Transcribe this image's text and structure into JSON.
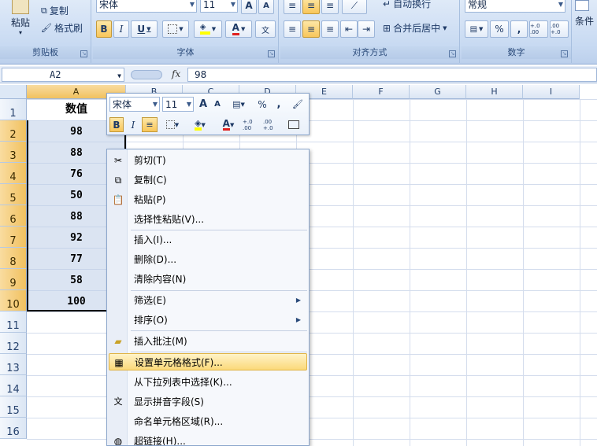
{
  "ribbon": {
    "clipboard": {
      "paste": "粘贴",
      "copy": "复制",
      "format_painter": "格式刷",
      "label": "剪贴板"
    },
    "font": {
      "name": "宋体",
      "size": "11",
      "bold": "B",
      "italic": "I",
      "underline": "U",
      "grow": "A",
      "shrink": "A",
      "label": "字体"
    },
    "alignment": {
      "wrap": "自动换行",
      "merge": "合并后居中",
      "label": "对齐方式"
    },
    "number": {
      "format": "常规",
      "percent": "%",
      "comma": ",",
      "inc_dec": "+.0 .00",
      "dec_dec": ".00 +.0",
      "label": "数字"
    },
    "styles": {
      "conditional": "条件"
    }
  },
  "formula_bar": {
    "cell_ref": "A2",
    "fx": "fx",
    "value": "98"
  },
  "columns": [
    "A",
    "B",
    "C",
    "D",
    "E",
    "F",
    "G",
    "H",
    "I"
  ],
  "rows": [
    "1",
    "2",
    "3",
    "4",
    "5",
    "6",
    "7",
    "8",
    "9",
    "10",
    "11",
    "12",
    "13",
    "14",
    "15",
    "16"
  ],
  "sheet": {
    "header": "数值",
    "values": [
      "98",
      "88",
      "76",
      "50",
      "88",
      "92",
      "77",
      "58",
      "100"
    ]
  },
  "mini_toolbar": {
    "font": "宋体",
    "size": "11",
    "grow": "A",
    "shrink": "A",
    "percent": "%",
    "comma": ",",
    "bold": "B",
    "italic": "I",
    "font_color": "A",
    "inc": "+.0 .00",
    "dec": ".00 +.0"
  },
  "context_menu": {
    "items": [
      {
        "label": "剪切(T)"
      },
      {
        "label": "复制(C)"
      },
      {
        "label": "粘贴(P)"
      },
      {
        "label": "选择性粘贴(V)..."
      },
      {
        "label": "插入(I)..."
      },
      {
        "label": "删除(D)..."
      },
      {
        "label": "清除内容(N)"
      },
      {
        "label": "筛选(E)"
      },
      {
        "label": "排序(O)"
      },
      {
        "label": "插入批注(M)"
      },
      {
        "label": "设置单元格格式(F)..."
      },
      {
        "label": "从下拉列表中选择(K)..."
      },
      {
        "label": "显示拼音字段(S)"
      },
      {
        "label": "命名单元格区域(R)..."
      },
      {
        "label": "超链接(H)..."
      }
    ]
  },
  "colors": {
    "selection_accent": "#f1c15f",
    "hover": "#fbd97a",
    "font_color_red": "#e02020",
    "fill_yellow": "#ffff00"
  }
}
